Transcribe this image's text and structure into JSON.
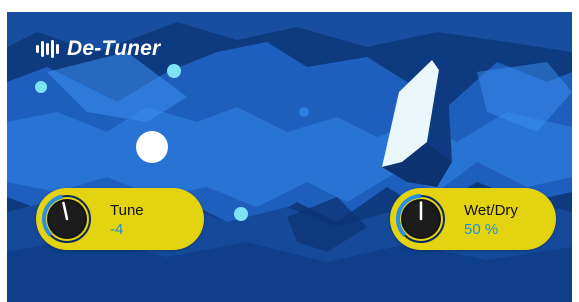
{
  "app": {
    "title": "De-Tuner",
    "logo_icon": "waveform-logo-icon"
  },
  "colors": {
    "accent_yellow": "#e4d311",
    "value_blue": "#1b8fd6",
    "background_blue": "#0f3a82"
  },
  "controls": {
    "tune": {
      "label": "Tune",
      "value": "-4"
    },
    "wetdry": {
      "label": "Wet/Dry",
      "value": "50 %"
    }
  }
}
